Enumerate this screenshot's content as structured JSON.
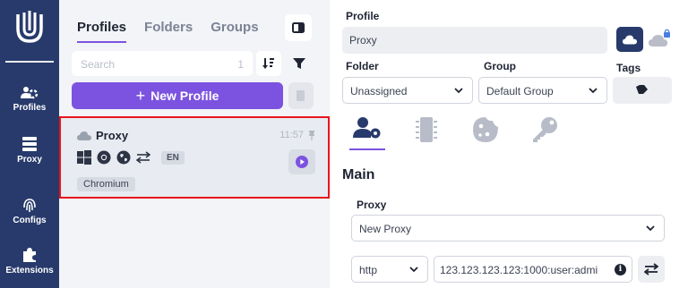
{
  "sidebar": {
    "items": [
      {
        "label": "Profiles",
        "icon": "profiles-icon"
      },
      {
        "label": "Proxy",
        "icon": "proxy-icon"
      },
      {
        "label": "Configs",
        "icon": "fingerprint-icon"
      },
      {
        "label": "Extensions",
        "icon": "puzzle-icon"
      }
    ]
  },
  "list": {
    "tabs": [
      "Profiles",
      "Folders",
      "Groups"
    ],
    "active_tab": "Profiles",
    "search_placeholder": "Search",
    "count": "1",
    "new_profile_label": "New Profile",
    "profile": {
      "name": "Proxy",
      "time": "11:57",
      "lang": "EN",
      "browser": "Chromium"
    }
  },
  "detail": {
    "profile_label": "Profile",
    "profile_value": "Proxy",
    "folder_label": "Folder",
    "folder_value": "Unassigned",
    "group_label": "Group",
    "group_value": "Default Group",
    "tags_label": "Tags",
    "main_heading": "Main",
    "proxy_label": "Proxy",
    "proxy_value": "New Proxy",
    "proxy_type": "http",
    "proxy_string": "123.123.123.123:1000:user:admi"
  },
  "colors": {
    "rail": "#283a6b",
    "accent": "#7c53e0",
    "highlight_border": "#e8141c"
  }
}
